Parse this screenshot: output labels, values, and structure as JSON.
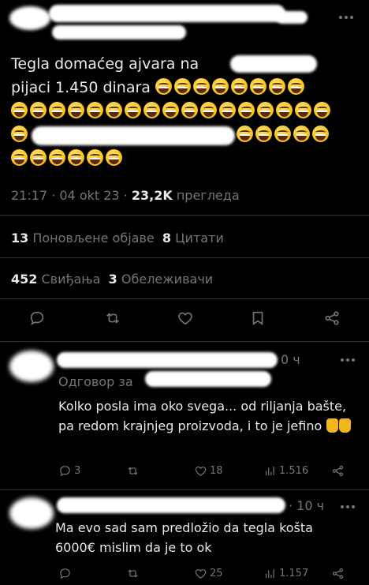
{
  "tweet": {
    "text_line1": "Tegla domaćeg ajvara na",
    "text_line2": "pijaci 1.450 dinara",
    "time": "21:17",
    "date": "04 okt 23",
    "views_count": "23,2K",
    "views_label": "прегледа",
    "reposts_count": "13",
    "reposts_label": "Поновљене објаве",
    "quotes_count": "8",
    "quotes_label": "Цитати",
    "likes_count": "452",
    "likes_label": "Свиђања",
    "bookmarks_count": "3",
    "bookmarks_label": "Обележивачи"
  },
  "actions": {
    "icons": [
      "reply-icon",
      "retweet-icon",
      "like-icon",
      "bookmark-icon",
      "share-icon"
    ]
  },
  "replies": [
    {
      "time_suffix": "0 ч",
      "replying_to": "Одговор за",
      "text": "Kolko posla ima oko svega... od riljanja bašte, pa redom krajnjeg proizvoda, i to je jefino",
      "replies": "3",
      "retweets": "",
      "likes": "18",
      "views": "1.516"
    },
    {
      "time_suffix": "· 10 ч",
      "text": "Ma evo sad sam predložio da tegla košta 6000€ mislim da je to ok",
      "replies": "",
      "retweets": "",
      "likes": "25",
      "views": "1.157"
    }
  ],
  "colors": {
    "background": "#000000",
    "text": "#e7e9ea",
    "muted": "#71767b",
    "divider": "#2f3336"
  }
}
